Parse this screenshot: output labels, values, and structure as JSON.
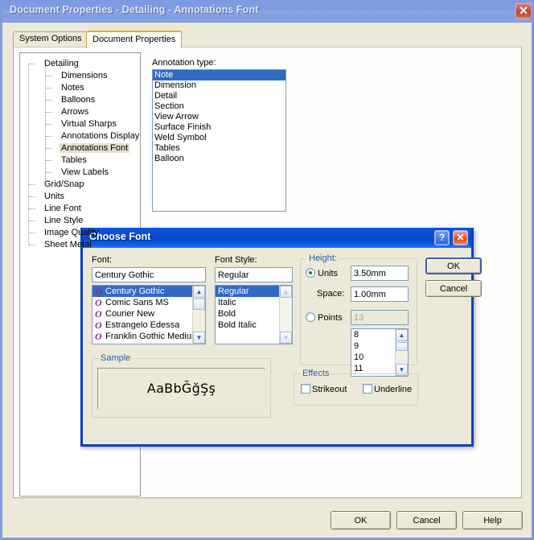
{
  "window": {
    "title": "Document Properties - Detailing - Annotations Font",
    "close_icon": "close-icon",
    "close_glyph": "✕"
  },
  "tabs": [
    {
      "label": "System Options",
      "active": false
    },
    {
      "label": "Document Properties",
      "active": true
    }
  ],
  "tree": {
    "items": [
      {
        "label": "Detailing",
        "level": 0,
        "selected": false
      },
      {
        "label": "Dimensions",
        "level": 1,
        "selected": false
      },
      {
        "label": "Notes",
        "level": 1,
        "selected": false
      },
      {
        "label": "Balloons",
        "level": 1,
        "selected": false
      },
      {
        "label": "Arrows",
        "level": 1,
        "selected": false
      },
      {
        "label": "Virtual Sharps",
        "level": 1,
        "selected": false
      },
      {
        "label": "Annotations Display",
        "level": 1,
        "selected": false
      },
      {
        "label": "Annotations Font",
        "level": 1,
        "selected": true
      },
      {
        "label": "Tables",
        "level": 1,
        "selected": false
      },
      {
        "label": "View Labels",
        "level": 1,
        "selected": false
      },
      {
        "label": "Grid/Snap",
        "level": 0,
        "selected": false
      },
      {
        "label": "Units",
        "level": 0,
        "selected": false
      },
      {
        "label": "Line Font",
        "level": 0,
        "selected": false
      },
      {
        "label": "Line Style",
        "level": 0,
        "selected": false
      },
      {
        "label": "Image Quality",
        "level": 0,
        "selected": false
      },
      {
        "label": "Sheet Metal",
        "level": 0,
        "selected": false
      }
    ]
  },
  "main": {
    "annotation_type_label": "Annotation type:",
    "annotation_types": [
      {
        "label": "Note",
        "selected": true
      },
      {
        "label": "Dimension",
        "selected": false
      },
      {
        "label": "Detail",
        "selected": false
      },
      {
        "label": "Section",
        "selected": false
      },
      {
        "label": "View Arrow",
        "selected": false
      },
      {
        "label": "Surface Finish",
        "selected": false
      },
      {
        "label": "Weld Symbol",
        "selected": false
      },
      {
        "label": "Tables",
        "selected": false
      },
      {
        "label": "Balloon",
        "selected": false
      }
    ]
  },
  "bottom_buttons": {
    "ok": "OK",
    "cancel": "Cancel",
    "help": "Help"
  },
  "font_dialog": {
    "title": "Choose Font",
    "help_glyph": "?",
    "close_glyph": "✕",
    "font_label": "Font:",
    "font_value": "Century Gothic",
    "font_list": [
      {
        "label": "Century Gothic",
        "selected": true
      },
      {
        "label": "Comic Sans MS",
        "selected": false
      },
      {
        "label": "Courier New",
        "selected": false
      },
      {
        "label": "Estrangelo Edessa",
        "selected": false
      },
      {
        "label": "Franklin Gothic Medium",
        "selected": false
      }
    ],
    "font_icon_glyph": "O",
    "style_label": "Font Style:",
    "style_value": "Regular",
    "style_list": [
      {
        "label": "Regular",
        "selected": true
      },
      {
        "label": "Italic",
        "selected": false
      },
      {
        "label": "Bold",
        "selected": false
      },
      {
        "label": "Bold Italic",
        "selected": false
      }
    ],
    "height_group": "Height:",
    "units_radio": "Units",
    "units_checked": true,
    "units_value": "3.50mm",
    "space_label": "Space:",
    "space_value": "1.00mm",
    "points_radio": "Points",
    "points_checked": false,
    "points_value": "13",
    "points_list": [
      {
        "label": "8",
        "selected": false
      },
      {
        "label": "9",
        "selected": false
      },
      {
        "label": "10",
        "selected": false
      },
      {
        "label": "11",
        "selected": false
      }
    ],
    "sample_group": "Sample",
    "sample_text": "AaBbĞğŞş",
    "effects_group": "Effects",
    "strikeout_label": "Strikeout",
    "strikeout_checked": false,
    "underline_label": "Underline",
    "underline_checked": false,
    "ok": "OK",
    "cancel": "Cancel"
  },
  "colors": {
    "window_face": "#ece9d8",
    "inactive_title": "#7f9be1",
    "active_title": "#0a4cd0",
    "selection_blue": "#316ac5",
    "tab_accent": "#f0a927",
    "groupbox_title": "#2a5caa",
    "ttf_icon": "#7b2f8e"
  }
}
